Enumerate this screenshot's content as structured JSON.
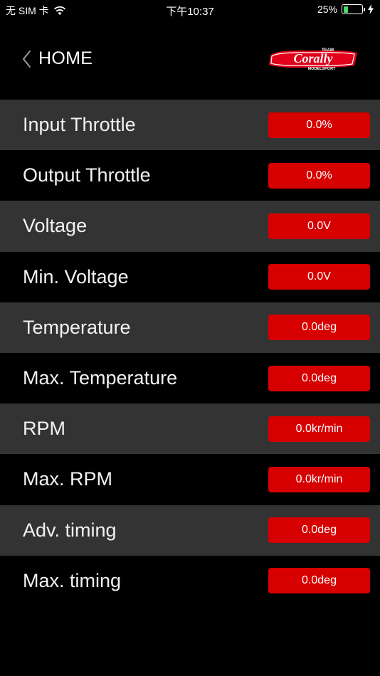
{
  "status_bar": {
    "carrier": "无 SIM 卡",
    "time": "下午10:37",
    "battery_percent": "25%",
    "battery_level": 0.25,
    "icons": [
      "wifi-icon",
      "battery-icon",
      "charging-bolt-icon"
    ]
  },
  "nav": {
    "back_label": "HOME",
    "back_icon": "chevron-left-icon",
    "logo": {
      "top": "TEAM",
      "main": "Corally",
      "bottom": "MODELSPORT"
    }
  },
  "colors": {
    "background": "#000000",
    "row_alt": "#333333",
    "value_box": "#d60000",
    "battery_fill": "#4cd964"
  },
  "rows": [
    {
      "label": "Input Throttle",
      "value": "0.0%"
    },
    {
      "label": "Output Throttle",
      "value": "0.0%"
    },
    {
      "label": "Voltage",
      "value": "0.0V"
    },
    {
      "label": "Min. Voltage",
      "value": "0.0V"
    },
    {
      "label": "Temperature",
      "value": "0.0deg"
    },
    {
      "label": "Max. Temperature",
      "value": "0.0deg"
    },
    {
      "label": "RPM",
      "value": "0.0kr/min"
    },
    {
      "label": "Max. RPM",
      "value": "0.0kr/min"
    },
    {
      "label": "Adv. timing",
      "value": "0.0deg"
    },
    {
      "label": "Max. timing",
      "value": "0.0deg"
    }
  ]
}
